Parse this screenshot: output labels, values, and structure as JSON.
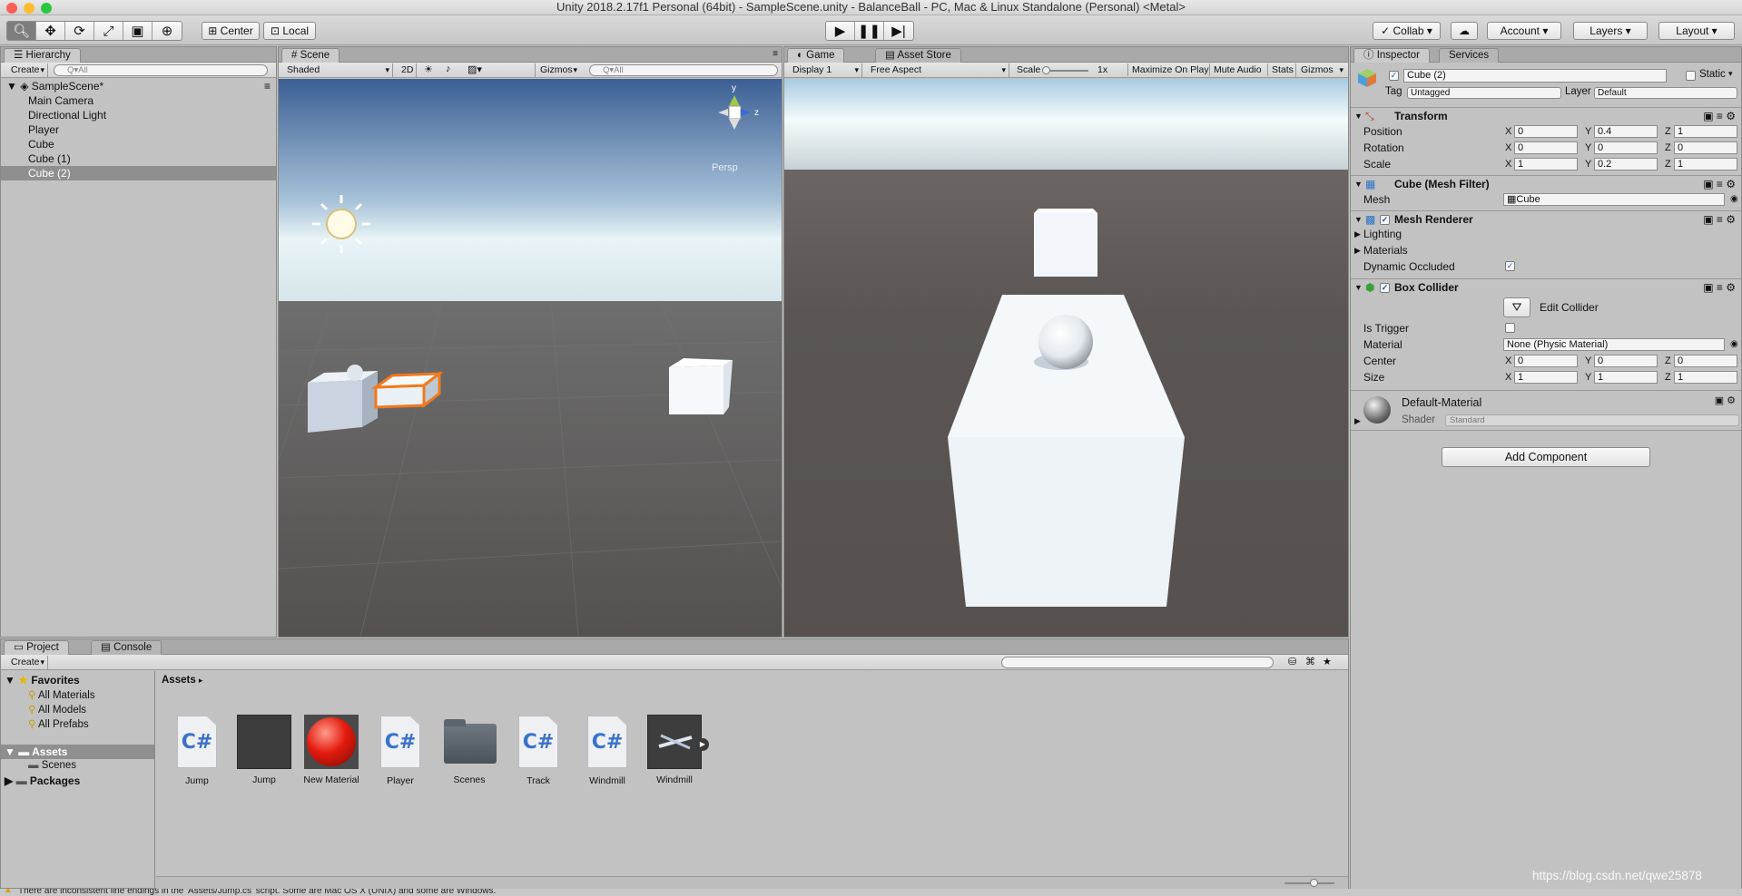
{
  "window": {
    "title": "Unity 2018.2.17f1 Personal (64bit) - SampleScene.unity - BalanceBall - PC, Mac & Linux Standalone (Personal) <Metal>"
  },
  "toolbar": {
    "pivot": "Center",
    "space": "Local",
    "collab": "Collab",
    "account": "Account",
    "layers": "Layers",
    "layout": "Layout"
  },
  "hierarchy": {
    "tab": "Hierarchy",
    "create": "Create",
    "search_placeholder": "Q▾All",
    "scene": "SampleScene*",
    "items": [
      "Main Camera",
      "Directional Light",
      "Player",
      "Cube",
      "Cube (1)",
      "Cube (2)"
    ],
    "selected_index": 5
  },
  "scene_view": {
    "tab": "Scene",
    "shading": "Shaded",
    "mode_2d": "2D",
    "gizmos": "Gizmos",
    "search_placeholder": "Q▾All",
    "projection": "Persp",
    "axis_y": "y",
    "axis_z": "z"
  },
  "game_view": {
    "tab": "Game",
    "asset_store_tab": "Asset Store",
    "display": "Display 1",
    "aspect": "Free Aspect",
    "scale_label": "Scale",
    "scale_value": "1x",
    "maximize": "Maximize On Play",
    "mute": "Mute Audio",
    "stats": "Stats",
    "gizmos": "Gizmos"
  },
  "inspector": {
    "tab": "Inspector",
    "services_tab": "Services",
    "object_name": "Cube (2)",
    "static_label": "Static",
    "tag_label": "Tag",
    "tag_value": "Untagged",
    "layer_label": "Layer",
    "layer_value": "Default",
    "transform": {
      "title": "Transform",
      "position": {
        "label": "Position",
        "x": "0",
        "y": "0.4",
        "z": "1"
      },
      "rotation": {
        "label": "Rotation",
        "x": "0",
        "y": "0",
        "z": "0"
      },
      "scale": {
        "label": "Scale",
        "x": "1",
        "y": "0.2",
        "z": "1"
      }
    },
    "mesh_filter": {
      "title": "Cube (Mesh Filter)",
      "mesh_label": "Mesh",
      "mesh_value": "Cube"
    },
    "mesh_renderer": {
      "title": "Mesh Renderer",
      "lighting": "Lighting",
      "materials": "Materials",
      "dynamic_occluded": "Dynamic Occluded"
    },
    "box_collider": {
      "title": "Box Collider",
      "edit_collider": "Edit Collider",
      "is_trigger": "Is Trigger",
      "material_label": "Material",
      "material_value": "None (Physic Material)",
      "center": {
        "label": "Center",
        "x": "0",
        "y": "0",
        "z": "0"
      },
      "size": {
        "label": "Size",
        "x": "1",
        "y": "1",
        "z": "1"
      }
    },
    "material": {
      "name": "Default-Material",
      "shader_label": "Shader",
      "shader_value": "Standard"
    },
    "add_component": "Add Component",
    "axis": {
      "x": "X",
      "y": "Y",
      "z": "Z"
    }
  },
  "project": {
    "tab": "Project",
    "console_tab": "Console",
    "create": "Create",
    "favorites": "Favorites",
    "favorite_items": [
      "All Materials",
      "All Models",
      "All Prefabs"
    ],
    "assets_root": "Assets",
    "scenes_folder": "Scenes",
    "packages": "Packages",
    "breadcrumb": "Assets",
    "assets": [
      {
        "name": "Jump",
        "kind": "script"
      },
      {
        "name": "Jump",
        "kind": "material-dark"
      },
      {
        "name": "New Material",
        "kind": "material-red"
      },
      {
        "name": "Player",
        "kind": "script"
      },
      {
        "name": "Scenes",
        "kind": "folder"
      },
      {
        "name": "Track",
        "kind": "script"
      },
      {
        "name": "Windmill",
        "kind": "script"
      },
      {
        "name": "Windmill",
        "kind": "prefab"
      }
    ]
  },
  "status_bar": {
    "message": "There are inconsistent line endings in the 'Assets/Jump.cs' script. Some are Mac OS X (UNIX) and some are Windows.",
    "watermark": "https://blog.csdn.net/qwe25878"
  },
  "colors": {
    "selection": "#8f8f8f",
    "selected_outline": "#f07a1e",
    "game_floor": "#5a5552"
  }
}
